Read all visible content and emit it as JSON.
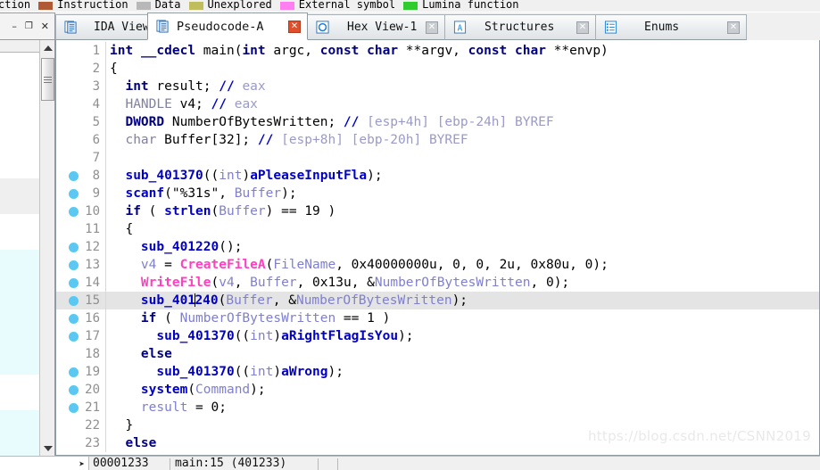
{
  "legend": {
    "items": [
      {
        "label": "ction",
        "color": "#ffffff",
        "swatch": false
      },
      {
        "label": "Instruction",
        "color": "#b05a35",
        "swatch": true
      },
      {
        "label": "Data",
        "color": "#b8b8b8",
        "swatch": true
      },
      {
        "label": "Unexplored",
        "color": "#c0bd5e",
        "swatch": true
      },
      {
        "label": "External symbol",
        "color": "#ff7ff0",
        "swatch": true
      },
      {
        "label": "Lumina function",
        "color": "#2ecc2e",
        "swatch": true
      }
    ]
  },
  "window_controls": {
    "minimize": "–",
    "restore": "❐",
    "close": "✕"
  },
  "tabs": [
    {
      "label": "IDA View-A",
      "icon": "document-blue-icon",
      "active": false,
      "close": "✕"
    },
    {
      "label": "Pseudocode-A",
      "icon": "document-blue-icon",
      "active": true,
      "close": "✕"
    },
    {
      "label": "Hex View-1",
      "icon": "hex-circle-icon",
      "active": false,
      "close": "✕"
    },
    {
      "label": "Structures",
      "icon": "structures-a-icon",
      "active": false,
      "close": "✕"
    },
    {
      "label": "Enums",
      "icon": "enums-list-icon",
      "active": false,
      "close": "✕"
    }
  ],
  "left_panel": {
    "row_colors": [
      "#ffffff",
      "#ffffff",
      "#ffffff",
      "#ffffff",
      "#ffffff",
      "#ffffff",
      "#ffffff",
      "#efefef",
      "#efefef",
      "#ffffff",
      "#ffffff",
      "#e8fbfd",
      "#e8fbfd",
      "#e8fbfd",
      "#e8fbfd",
      "#e8fbfd",
      "#e8fbfd",
      "#e8fbfd",
      "#ffffff",
      "#ffffff",
      "#e8fbfd",
      "#e8fbfd",
      "#e8fbfd"
    ],
    "scrollbar": {
      "up_arrow": "▲",
      "down_arrow": "▼"
    }
  },
  "code": {
    "lines": [
      {
        "n": 1,
        "bp": false,
        "hl": false,
        "tokens": [
          {
            "t": "int",
            "c": "t-type"
          },
          {
            "t": " ",
            "c": "t-plain"
          },
          {
            "t": "__cdecl",
            "c": "t-kw"
          },
          {
            "t": " ",
            "c": "t-plain"
          },
          {
            "t": "main",
            "c": "t-plain"
          },
          {
            "t": "(",
            "c": "t-punc"
          },
          {
            "t": "int",
            "c": "t-type"
          },
          {
            "t": " argc, ",
            "c": "t-plain"
          },
          {
            "t": "const",
            "c": "t-type"
          },
          {
            "t": " ",
            "c": "t-plain"
          },
          {
            "t": "char",
            "c": "t-type"
          },
          {
            "t": " **argv, ",
            "c": "t-plain"
          },
          {
            "t": "const",
            "c": "t-type"
          },
          {
            "t": " ",
            "c": "t-plain"
          },
          {
            "t": "char",
            "c": "t-type"
          },
          {
            "t": " **envp)",
            "c": "t-plain"
          }
        ]
      },
      {
        "n": 2,
        "bp": false,
        "hl": false,
        "tokens": [
          {
            "t": "{",
            "c": "t-punc"
          }
        ]
      },
      {
        "n": 3,
        "bp": false,
        "hl": false,
        "tokens": [
          {
            "t": "  ",
            "c": "t-plain"
          },
          {
            "t": "int",
            "c": "t-type"
          },
          {
            "t": " result; ",
            "c": "t-plain"
          },
          {
            "t": "//",
            "c": "t-fn"
          },
          {
            "t": " eax",
            "c": "t-cmt"
          }
        ]
      },
      {
        "n": 4,
        "bp": false,
        "hl": false,
        "tokens": [
          {
            "t": "  ",
            "c": "t-plain"
          },
          {
            "t": "HANDLE",
            "c": "t-lib"
          },
          {
            "t": " v4; ",
            "c": "t-plain"
          },
          {
            "t": "//",
            "c": "t-fn"
          },
          {
            "t": " eax",
            "c": "t-cmt"
          }
        ]
      },
      {
        "n": 5,
        "bp": false,
        "hl": false,
        "tokens": [
          {
            "t": "  ",
            "c": "t-plain"
          },
          {
            "t": "DWORD",
            "c": "t-kw"
          },
          {
            "t": " NumberOfBytesWritten; ",
            "c": "t-plain"
          },
          {
            "t": "//",
            "c": "t-fn"
          },
          {
            "t": " [esp+4h] [ebp-24h] BYREF",
            "c": "t-cmt"
          }
        ]
      },
      {
        "n": 6,
        "bp": false,
        "hl": false,
        "tokens": [
          {
            "t": "  ",
            "c": "t-plain"
          },
          {
            "t": "char",
            "c": "t-lib"
          },
          {
            "t": " Buffer[32]; ",
            "c": "t-plain"
          },
          {
            "t": "//",
            "c": "t-fn"
          },
          {
            "t": " [esp+8h] [ebp-20h] BYREF",
            "c": "t-cmt"
          }
        ]
      },
      {
        "n": 7,
        "bp": false,
        "hl": false,
        "tokens": [
          {
            "t": "",
            "c": "t-plain"
          }
        ]
      },
      {
        "n": 8,
        "bp": true,
        "hl": false,
        "tokens": [
          {
            "t": "  ",
            "c": "t-plain"
          },
          {
            "t": "sub_401370",
            "c": "t-fn"
          },
          {
            "t": "((",
            "c": "t-punc"
          },
          {
            "t": "int",
            "c": "t-var"
          },
          {
            "t": ")",
            "c": "t-punc"
          },
          {
            "t": "aPleaseInputFla",
            "c": "t-fn"
          },
          {
            "t": ");",
            "c": "t-punc"
          }
        ]
      },
      {
        "n": 9,
        "bp": true,
        "hl": false,
        "tokens": [
          {
            "t": "  ",
            "c": "t-plain"
          },
          {
            "t": "scanf",
            "c": "t-fn"
          },
          {
            "t": "(",
            "c": "t-punc"
          },
          {
            "t": "\"%31s\"",
            "c": "t-plain"
          },
          {
            "t": ", ",
            "c": "t-punc"
          },
          {
            "t": "Buffer",
            "c": "t-var"
          },
          {
            "t": ");",
            "c": "t-punc"
          }
        ]
      },
      {
        "n": 10,
        "bp": true,
        "hl": false,
        "tokens": [
          {
            "t": "  ",
            "c": "t-plain"
          },
          {
            "t": "if",
            "c": "t-kw"
          },
          {
            "t": " ( ",
            "c": "t-plain"
          },
          {
            "t": "strlen",
            "c": "t-fn"
          },
          {
            "t": "(",
            "c": "t-punc"
          },
          {
            "t": "Buffer",
            "c": "t-var"
          },
          {
            "t": ") == ",
            "c": "t-plain"
          },
          {
            "t": "19",
            "c": "t-num"
          },
          {
            "t": " )",
            "c": "t-plain"
          }
        ]
      },
      {
        "n": 11,
        "bp": false,
        "hl": false,
        "tokens": [
          {
            "t": "  {",
            "c": "t-punc"
          }
        ]
      },
      {
        "n": 12,
        "bp": true,
        "hl": false,
        "tokens": [
          {
            "t": "    ",
            "c": "t-plain"
          },
          {
            "t": "sub_401220",
            "c": "t-fn"
          },
          {
            "t": "();",
            "c": "t-punc"
          }
        ]
      },
      {
        "n": 13,
        "bp": true,
        "hl": false,
        "tokens": [
          {
            "t": "    ",
            "c": "t-plain"
          },
          {
            "t": "v4",
            "c": "t-var"
          },
          {
            "t": " = ",
            "c": "t-plain"
          },
          {
            "t": "CreateFileA",
            "c": "t-api"
          },
          {
            "t": "(",
            "c": "t-punc"
          },
          {
            "t": "FileName",
            "c": "t-var"
          },
          {
            "t": ", ",
            "c": "t-punc"
          },
          {
            "t": "0x40000000u",
            "c": "t-num"
          },
          {
            "t": ", ",
            "c": "t-punc"
          },
          {
            "t": "0",
            "c": "t-num"
          },
          {
            "t": ", ",
            "c": "t-punc"
          },
          {
            "t": "0",
            "c": "t-num"
          },
          {
            "t": ", ",
            "c": "t-punc"
          },
          {
            "t": "2u",
            "c": "t-num"
          },
          {
            "t": ", ",
            "c": "t-punc"
          },
          {
            "t": "0x80u",
            "c": "t-num"
          },
          {
            "t": ", ",
            "c": "t-punc"
          },
          {
            "t": "0",
            "c": "t-num"
          },
          {
            "t": ");",
            "c": "t-punc"
          }
        ]
      },
      {
        "n": 14,
        "bp": true,
        "hl": false,
        "tokens": [
          {
            "t": "    ",
            "c": "t-plain"
          },
          {
            "t": "WriteFile",
            "c": "t-api"
          },
          {
            "t": "(",
            "c": "t-punc"
          },
          {
            "t": "v4",
            "c": "t-var"
          },
          {
            "t": ", ",
            "c": "t-punc"
          },
          {
            "t": "Buffer",
            "c": "t-var"
          },
          {
            "t": ", ",
            "c": "t-punc"
          },
          {
            "t": "0x13u",
            "c": "t-num"
          },
          {
            "t": ", &",
            "c": "t-punc"
          },
          {
            "t": "NumberOfBytesWritten",
            "c": "t-var"
          },
          {
            "t": ", ",
            "c": "t-punc"
          },
          {
            "t": "0",
            "c": "t-num"
          },
          {
            "t": ");",
            "c": "t-punc"
          }
        ]
      },
      {
        "n": 15,
        "bp": true,
        "hl": true,
        "caret_after": 2,
        "tokens": [
          {
            "t": "    ",
            "c": "t-plain"
          },
          {
            "t": "sub_401240",
            "c": "t-fn",
            "caret_index": 7
          },
          {
            "t": "(",
            "c": "t-punc"
          },
          {
            "t": "Buffer",
            "c": "t-var"
          },
          {
            "t": ", &",
            "c": "t-punc"
          },
          {
            "t": "NumberOfBytesWritten",
            "c": "t-var"
          },
          {
            "t": ");",
            "c": "t-punc"
          }
        ]
      },
      {
        "n": 16,
        "bp": true,
        "hl": false,
        "tokens": [
          {
            "t": "    ",
            "c": "t-plain"
          },
          {
            "t": "if",
            "c": "t-kw"
          },
          {
            "t": " ( ",
            "c": "t-plain"
          },
          {
            "t": "NumberOfBytesWritten",
            "c": "t-var"
          },
          {
            "t": " == ",
            "c": "t-plain"
          },
          {
            "t": "1",
            "c": "t-num"
          },
          {
            "t": " )",
            "c": "t-plain"
          }
        ]
      },
      {
        "n": 17,
        "bp": true,
        "hl": false,
        "tokens": [
          {
            "t": "      ",
            "c": "t-plain"
          },
          {
            "t": "sub_401370",
            "c": "t-fn"
          },
          {
            "t": "((",
            "c": "t-punc"
          },
          {
            "t": "int",
            "c": "t-var"
          },
          {
            "t": ")",
            "c": "t-punc"
          },
          {
            "t": "aRightFlagIsYou",
            "c": "t-fn"
          },
          {
            "t": ");",
            "c": "t-punc"
          }
        ]
      },
      {
        "n": 18,
        "bp": false,
        "hl": false,
        "tokens": [
          {
            "t": "    ",
            "c": "t-plain"
          },
          {
            "t": "else",
            "c": "t-kw"
          }
        ]
      },
      {
        "n": 19,
        "bp": true,
        "hl": false,
        "tokens": [
          {
            "t": "      ",
            "c": "t-plain"
          },
          {
            "t": "sub_401370",
            "c": "t-fn"
          },
          {
            "t": "((",
            "c": "t-punc"
          },
          {
            "t": "int",
            "c": "t-var"
          },
          {
            "t": ")",
            "c": "t-punc"
          },
          {
            "t": "aWrong",
            "c": "t-fn"
          },
          {
            "t": ");",
            "c": "t-punc"
          }
        ]
      },
      {
        "n": 20,
        "bp": true,
        "hl": false,
        "tokens": [
          {
            "t": "    ",
            "c": "t-plain"
          },
          {
            "t": "system",
            "c": "t-fn"
          },
          {
            "t": "(",
            "c": "t-punc"
          },
          {
            "t": "Command",
            "c": "t-var"
          },
          {
            "t": ");",
            "c": "t-punc"
          }
        ]
      },
      {
        "n": 21,
        "bp": true,
        "hl": false,
        "tokens": [
          {
            "t": "    ",
            "c": "t-plain"
          },
          {
            "t": "result",
            "c": "t-var"
          },
          {
            "t": " = ",
            "c": "t-plain"
          },
          {
            "t": "0",
            "c": "t-num"
          },
          {
            "t": ";",
            "c": "t-punc"
          }
        ]
      },
      {
        "n": 22,
        "bp": false,
        "hl": false,
        "tokens": [
          {
            "t": "  }",
            "c": "t-punc"
          }
        ]
      },
      {
        "n": 23,
        "bp": false,
        "hl": false,
        "tokens": [
          {
            "t": "  ",
            "c": "t-plain"
          },
          {
            "t": "else",
            "c": "t-kw"
          }
        ]
      }
    ]
  },
  "watermark": "https://blog.csdn.net/CSNN2019",
  "statusbar": {
    "address": "00001233",
    "symbol": "main:15 (401233)"
  }
}
